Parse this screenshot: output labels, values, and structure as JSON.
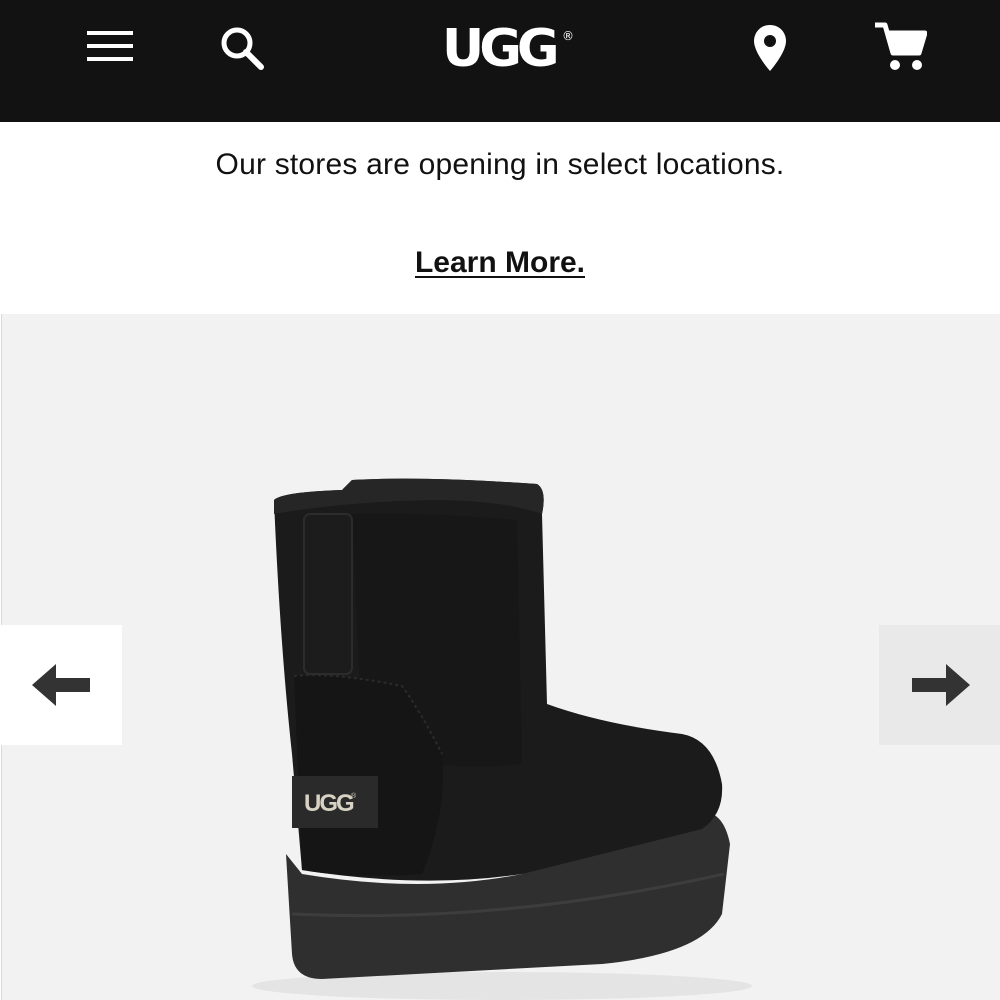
{
  "header": {
    "brand": "UGG",
    "registered_mark": "®",
    "icons": {
      "menu": "hamburger-menu-icon",
      "search": "search-icon",
      "location": "location-pin-icon",
      "cart": "shopping-cart-icon"
    },
    "colors": {
      "background": "#121212",
      "foreground": "#ffffff"
    }
  },
  "banner": {
    "message": "Our stores are opening in select locations.",
    "link_label": "Learn More."
  },
  "carousel": {
    "prev_icon": "arrow-left-icon",
    "next_icon": "arrow-right-icon",
    "product": {
      "image": "black-suede-ankle-boot",
      "heel_label": "UGG",
      "heel_label_mark": "®"
    }
  }
}
